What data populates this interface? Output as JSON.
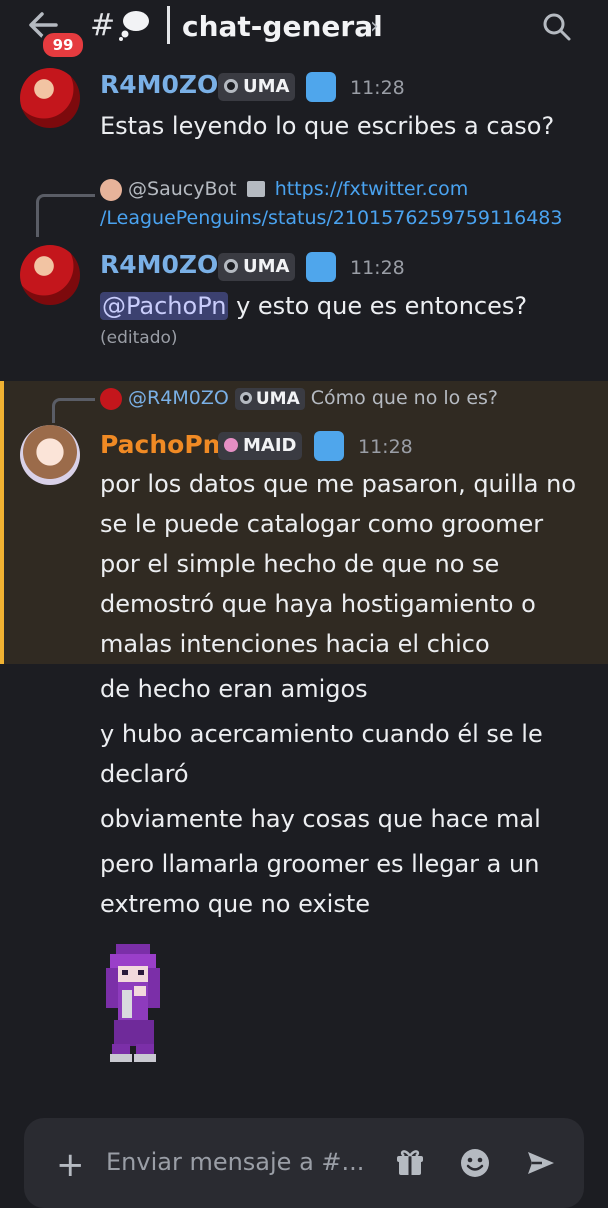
{
  "header": {
    "unread_badge": "99",
    "hash": "#",
    "channel_name": "chat-general",
    "chevron": "›"
  },
  "messages": [
    {
      "author": "R4M0ZO",
      "role_tag": "UMA",
      "time": "11:28",
      "text": "Estas leyendo lo que escribes a caso?"
    },
    {
      "reply": {
        "author": "@SaucyBot",
        "link_line1": "https://fxtwitter.com",
        "link_line2": "/LeaguePenguins/status/2101576259759116483"
      },
      "author": "R4M0ZO",
      "role_tag": "UMA",
      "time": "11:28",
      "mention": "@PachoPn",
      "text": " y esto que es entonces?",
      "edited": "(editado)"
    },
    {
      "reply": {
        "author": "@R4M0ZO",
        "role_tag": "UMA",
        "text": "Cómo que no lo es?"
      },
      "author": "PachoPn",
      "role_tag": "MAID",
      "time": "11:28",
      "lines": [
        "por los datos que me pasaron, quilla no",
        "se le puede catalogar como groomer",
        "por el simple hecho de que no se",
        "demostró que haya hostigamiento o",
        "malas intenciones hacia el chico"
      ]
    }
  ],
  "followups": [
    "de hecho eran amigos",
    "y hubo acercamiento cuando él se le",
    "declaró",
    "obviamente hay cosas que hace mal",
    "pero llamarla groomer es llegar a un",
    "extremo que no existe"
  ],
  "composer": {
    "plus": "+",
    "placeholder": "Enviar mensaje a #..."
  },
  "icons": {
    "back": "arrow-left-icon",
    "thought": "thought-balloon-icon",
    "search": "search-icon",
    "gift": "gift-icon",
    "emoji": "emoji-icon",
    "send": "send-icon"
  },
  "colors": {
    "background": "#1c1d22",
    "username_r4m0zo": "#7ab0e6",
    "username_pachopn": "#f08a24",
    "highlight_bar": "#f0b232",
    "link": "#4aa3f0",
    "badge": "#e53b3f"
  }
}
